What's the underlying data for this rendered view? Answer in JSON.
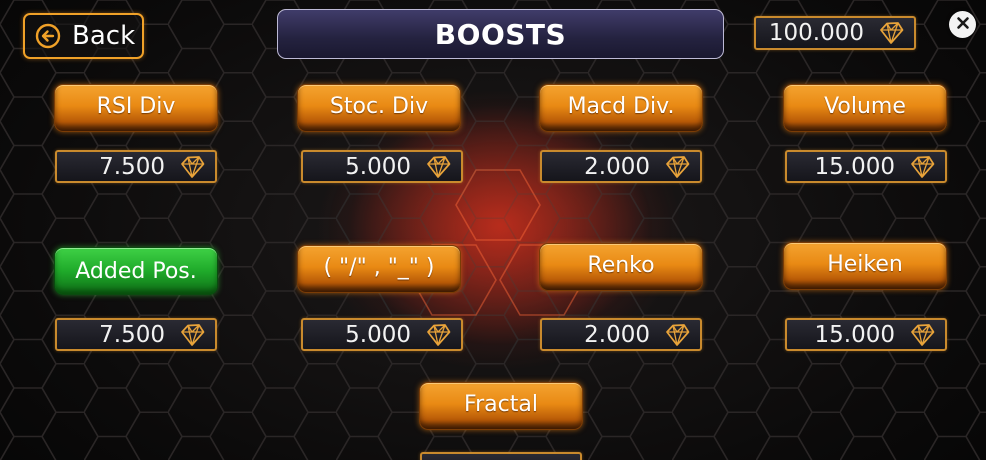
{
  "header": {
    "back_label": "Back",
    "title": "BOOSTS",
    "balance": "100.000"
  },
  "boosts": [
    {
      "label": "RSI Div",
      "price": "7.500",
      "state": "default"
    },
    {
      "label": "Stoc. Div",
      "price": "5.000",
      "state": "default"
    },
    {
      "label": "Macd Div.",
      "price": "2.000",
      "state": "default"
    },
    {
      "label": "Volume",
      "price": "15.000",
      "state": "default"
    },
    {
      "label": "Added Pos.",
      "price": "7.500",
      "state": "added"
    },
    {
      "label": "( \"/\" , \"_\" )",
      "price": "5.000",
      "state": "default"
    },
    {
      "label": "Renko",
      "price": "2.000",
      "state": "default"
    },
    {
      "label": "Heiken",
      "price": "15.000",
      "state": "default"
    },
    {
      "label": "Fractal",
      "state": "default"
    }
  ],
  "icons": {
    "back": "arrow-left-circle-icon",
    "currency": "diamond-icon",
    "close": "close-icon"
  },
  "colors": {
    "accent_orange": "#e98a14",
    "added_green": "#1faa2a",
    "title_bg": "#2c2a4a"
  }
}
